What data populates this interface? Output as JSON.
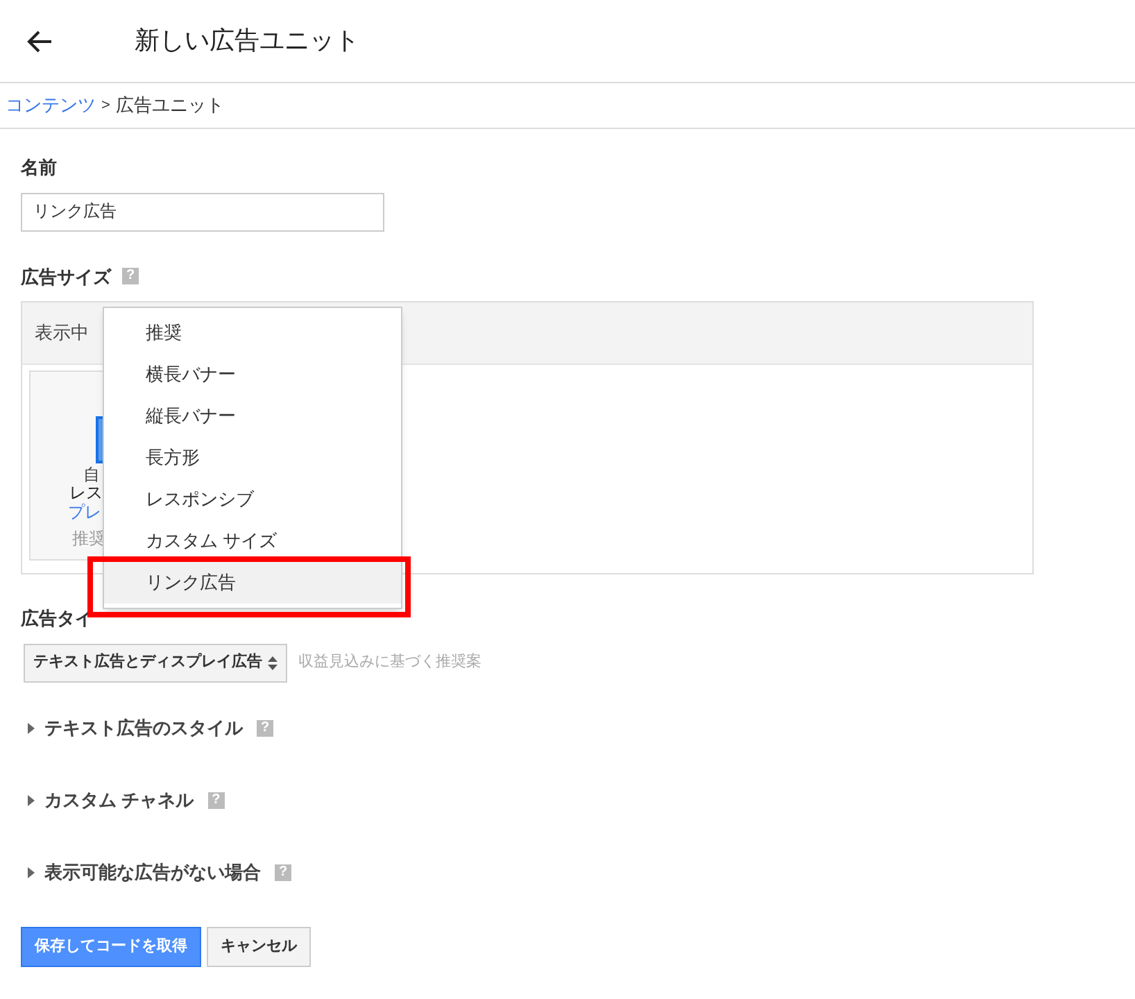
{
  "header": {
    "title": "新しい広告ユニット"
  },
  "breadcrumb": {
    "link": "コンテンツ",
    "separator": ">",
    "current": "広告ユニット"
  },
  "name_field": {
    "label": "名前",
    "value": "リンク広告"
  },
  "ad_size": {
    "label": "広告サイズ",
    "help_icon": "?",
    "tab_label": "表示中",
    "card_texts": [
      "自",
      "レス",
      "プレ",
      "推奨"
    ],
    "menu": [
      {
        "label": "推奨",
        "selected": false
      },
      {
        "label": "横長バナー",
        "selected": false
      },
      {
        "label": "縦長バナー",
        "selected": false
      },
      {
        "label": "長方形",
        "selected": false
      },
      {
        "label": "レスポンシブ",
        "selected": false
      },
      {
        "label": "カスタム サイズ",
        "selected": false
      },
      {
        "label": "リンク広告",
        "selected": true
      }
    ]
  },
  "ad_type": {
    "label": "広告タイ",
    "select_value": "テキスト広告とディスプレイ広告",
    "hint": "収益見込みに基づく推奨案"
  },
  "sections": [
    {
      "label": "テキスト広告のスタイル",
      "help_icon": "?",
      "expanded": false
    },
    {
      "label": "カスタム チャネル",
      "help_icon": "?",
      "expanded": false
    },
    {
      "label": "表示可能な広告がない場合",
      "help_icon": "?",
      "expanded": false
    }
  ],
  "buttons": [
    {
      "label": "保存してコードを取得",
      "kind": "primary"
    },
    {
      "label": "キャンセル",
      "kind": "secondary"
    }
  ]
}
